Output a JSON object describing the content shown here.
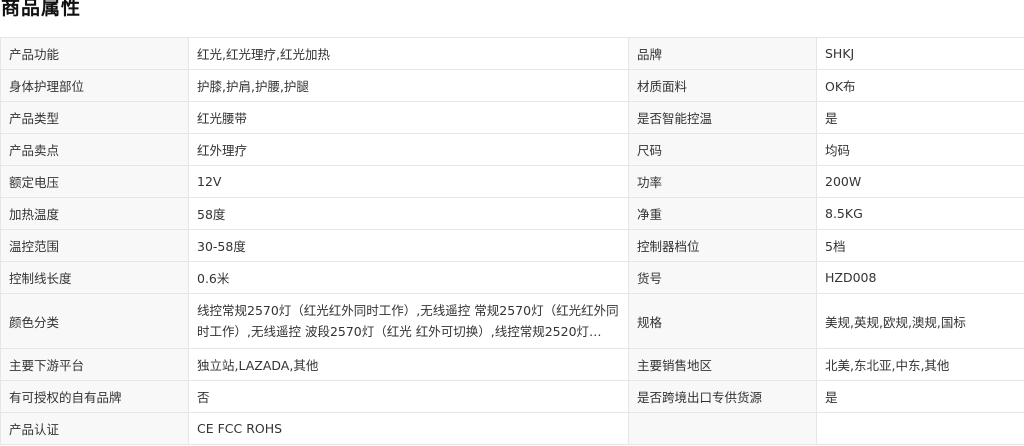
{
  "section": {
    "title": "商品属性"
  },
  "rows": [
    {
      "label1": "产品功能",
      "value1": "红光,红光理疗,红光加热",
      "label2": "品牌",
      "value2": "SHKJ"
    },
    {
      "label1": "身体护理部位",
      "value1": "护膝,护肩,护腰,护腿",
      "label2": "材质面料",
      "value2": "OK布"
    },
    {
      "label1": "产品类型",
      "value1": "红光腰带",
      "label2": "是否智能控温",
      "value2": "是"
    },
    {
      "label1": "产品卖点",
      "value1": "红外理疗",
      "label2": "尺码",
      "value2": "均码"
    },
    {
      "label1": "额定电压",
      "value1": "12V",
      "label2": "功率",
      "value2": "200W"
    },
    {
      "label1": "加热温度",
      "value1": "58度",
      "label2": "净重",
      "value2": "8.5KG"
    },
    {
      "label1": "温控范围",
      "value1": "30-58度",
      "label2": "控制器档位",
      "value2": "5档"
    },
    {
      "label1": "控制线长度",
      "value1": "0.6米",
      "label2": "货号",
      "value2": "HZD008"
    },
    {
      "label1": "颜色分类",
      "value1": "线控常规2570灯（红光红外同时工作）,无线遥控 常规2570灯（红光红外同时工作）,无线遥控 波段2570灯（红光 红外可切换）,线控常规2520灯（红...",
      "label2": "规格",
      "value2": "美规,英规,欧规,澳规,国标"
    },
    {
      "label1": "主要下游平台",
      "value1": "独立站,LAZADA,其他",
      "label2": "主要销售地区",
      "value2": "北美,东北亚,中东,其他"
    },
    {
      "label1": "有可授权的自有品牌",
      "value1": "否",
      "label2": "是否跨境出口专供货源",
      "value2": "是"
    },
    {
      "label1": "产品认证",
      "value1": "CE FCC ROHS",
      "label2": "",
      "value2": ""
    }
  ]
}
